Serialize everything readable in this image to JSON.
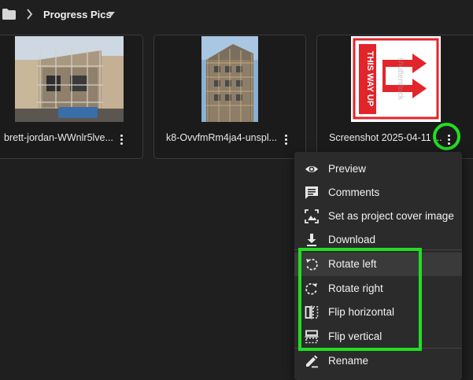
{
  "breadcrumb": {
    "folder_icon": "folder-icon",
    "separator_icon": "chevron-right-icon",
    "title": "Progress Pics",
    "dropdown_icon": "caret-down-icon"
  },
  "files": [
    {
      "name": "brett-jordan-WWnlr5lve...",
      "thumbnail": "house-construction-scaffolding-photo",
      "menu_icon": "more-vert-icon"
    },
    {
      "name": "k8-OvvfmRm4ja4-unspl...",
      "thumbnail": "building-scaffolding-photo",
      "menu_icon": "more-vert-icon"
    },
    {
      "name": "Screenshot 2025-04-11 ...",
      "thumbnail": "this-way-up-label-image",
      "menu_icon": "more-vert-icon"
    }
  ],
  "thumbnail_text": {
    "label": "THIS WAY UP",
    "watermark": "shutterstock"
  },
  "context_menu": {
    "items": [
      {
        "label": "Preview",
        "icon": "eye-icon"
      },
      {
        "label": "Comments",
        "icon": "comment-icon"
      },
      {
        "label": "Set as project cover image",
        "icon": "cover-image-icon"
      },
      {
        "label": "Download",
        "icon": "download-icon"
      },
      {
        "label": "Rotate left",
        "icon": "rotate-left-icon",
        "highlighted": true
      },
      {
        "label": "Rotate right",
        "icon": "rotate-right-icon"
      },
      {
        "label": "Flip horizontal",
        "icon": "flip-horizontal-icon"
      },
      {
        "label": "Flip vertical",
        "icon": "flip-vertical-icon"
      },
      {
        "label": "Rename",
        "icon": "rename-icon"
      }
    ]
  },
  "colors": {
    "background": "#1f1f1f",
    "menu_background": "#2b2b2b",
    "highlight_annotation": "#22dd22",
    "label_red": "#e2242b"
  }
}
